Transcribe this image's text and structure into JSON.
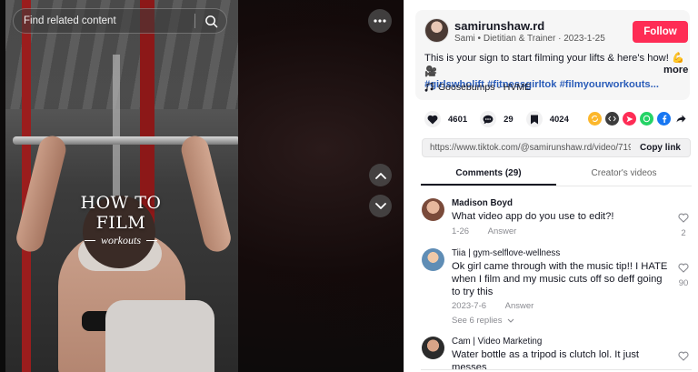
{
  "video": {
    "overlay_title": "HOW TO FILM",
    "overlay_subtitle": "workouts"
  },
  "search": {
    "placeholder": "Find related content"
  },
  "author": {
    "username": "samirunshaw.rd",
    "display_name": "Sami",
    "bio": "Dietitian & Trainer",
    "date": "2023-1-25",
    "meta": "Sami • Dietitian & Trainer · 2023-1-25",
    "follow_label": "Follow"
  },
  "post": {
    "caption": "This is your sign to start filming your lifts & here's how! 💪🎥",
    "hashtags": "#girlswholift #fitnessgirltok #filmyourworkouts...",
    "more_label": "more",
    "music": "Goosebumps - HVME"
  },
  "stats": {
    "likes": "4601",
    "comments": "29",
    "saves": "4024"
  },
  "share": {
    "url": "https://www.tiktok.com/@samirunshaw.rd/video/7192...",
    "copy_label": "Copy link"
  },
  "tabs": [
    {
      "label": "Comments (29)",
      "active": true
    },
    {
      "label": "Creator's videos",
      "active": false
    }
  ],
  "comments": [
    {
      "name": "Madison Boyd",
      "text": "What video app do you use to edit?!",
      "date": "1-26",
      "reply_label": "Answer",
      "likes": "2"
    },
    {
      "name": "Tiia | gym-selflove-wellness",
      "text": "Ok girl came through with the music tip!! I HATE when I film and my music cuts off so deff going to try this",
      "date": "2023-7-6",
      "reply_label": "Answer",
      "likes": "90",
      "see_replies": "See 6 replies"
    },
    {
      "name": "Cam | Video Marketing",
      "text": "Water bottle as a tripod is clutch lol. It just messes"
    }
  ],
  "colors": {
    "brand": "#fe2c55",
    "hashtag": "#2b5db9"
  }
}
